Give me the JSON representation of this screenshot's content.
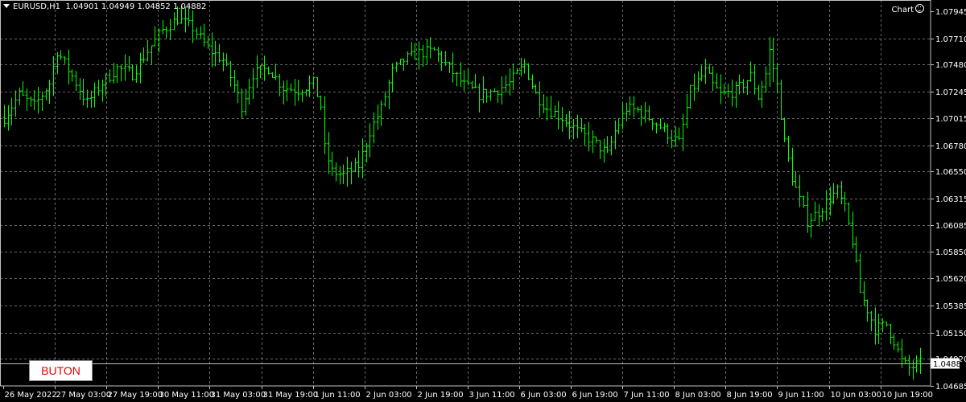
{
  "header": {
    "symbol": "EURUSD,H1",
    "ohlc": "1.04901 1.04949 1.04852 1.04882"
  },
  "chart_label": "Chart",
  "button_label": "BUTON",
  "colors": {
    "background": "#000000",
    "candle": "#00ff00",
    "grid": "#c0c0c0",
    "text": "#ffffff",
    "button_text": "#e00000",
    "current_price_line": "#c0c0c0"
  },
  "chart_data": {
    "type": "ohlc",
    "symbol": "EURUSD",
    "timeframe": "H1",
    "grid": true,
    "ylim": [
      1.04685,
      1.07945
    ],
    "y_ticks": [
      "1.07945",
      "1.07710",
      "1.07480",
      "1.07245",
      "1.07015",
      "1.06780",
      "1.06550",
      "1.06315",
      "1.06085",
      "1.05850",
      "1.05620",
      "1.05385",
      "1.05150",
      "1.04920",
      "1.04685"
    ],
    "x_ticks": [
      "26 May 2022",
      "27 May 03:00",
      "27 May 19:00",
      "30 May 11:00",
      "31 May 03:00",
      "31 May 19:00",
      "1 Jun 11:00",
      "2 Jun 03:00",
      "2 Jun 19:00",
      "3 Jun 11:00",
      "6 Jun 03:00",
      "6 Jun 19:00",
      "7 Jun 11:00",
      "8 Jun 03:00",
      "8 Jun 19:00",
      "9 Jun 11:00",
      "10 Jun 03:00",
      "10 Jun 19:00"
    ],
    "current_price": "1.04882",
    "close_path": [
      [
        0,
        1.0702
      ],
      [
        4,
        1.0722
      ],
      [
        8,
        1.0712
      ],
      [
        12,
        1.0732
      ],
      [
        14,
        1.076
      ],
      [
        18,
        1.0738
      ],
      [
        22,
        1.0715
      ],
      [
        26,
        1.0732
      ],
      [
        30,
        1.0745
      ],
      [
        34,
        1.074
      ],
      [
        38,
        1.076
      ],
      [
        42,
        1.0778
      ],
      [
        46,
        1.0788
      ],
      [
        50,
        1.078
      ],
      [
        54,
        1.0762
      ],
      [
        58,
        1.0752
      ],
      [
        61,
        1.073
      ],
      [
        63,
        1.0712
      ],
      [
        66,
        1.074
      ],
      [
        70,
        1.0745
      ],
      [
        74,
        1.0728
      ],
      [
        78,
        1.0726
      ],
      [
        82,
        1.0732
      ],
      [
        84,
        1.0712
      ],
      [
        85,
        1.0675
      ],
      [
        87,
        1.0655
      ],
      [
        90,
        1.0652
      ],
      [
        94,
        1.066
      ],
      [
        97,
        1.069
      ],
      [
        100,
        1.071
      ],
      [
        103,
        1.0742
      ],
      [
        106,
        1.0752
      ],
      [
        110,
        1.0758
      ],
      [
        114,
        1.076
      ],
      [
        118,
        1.0745
      ],
      [
        122,
        1.073
      ],
      [
        126,
        1.0722
      ],
      [
        130,
        1.0725
      ],
      [
        134,
        1.0732
      ],
      [
        138,
        1.0748
      ],
      [
        141,
        1.0722
      ],
      [
        144,
        1.071
      ],
      [
        148,
        1.0702
      ],
      [
        152,
        1.069
      ],
      [
        156,
        1.0682
      ],
      [
        160,
        1.067
      ],
      [
        162,
        1.069
      ],
      [
        165,
        1.071
      ],
      [
        168,
        1.0708
      ],
      [
        172,
        1.07
      ],
      [
        176,
        1.0688
      ],
      [
        179,
        1.068
      ],
      [
        182,
        1.0725
      ],
      [
        186,
        1.0742
      ],
      [
        188,
        1.073
      ],
      [
        190,
        1.0722
      ],
      [
        194,
        1.0725
      ],
      [
        198,
        1.0738
      ],
      [
        200,
        1.072
      ],
      [
        202,
        1.074
      ],
      [
        203,
        1.076
      ],
      [
        205,
        1.073
      ],
      [
        207,
        1.068
      ],
      [
        209,
        1.065
      ],
      [
        211,
        1.063
      ],
      [
        213,
        1.0612
      ],
      [
        216,
        1.062
      ],
      [
        219,
        1.0632
      ],
      [
        221,
        1.0638
      ],
      [
        223,
        1.0622
      ],
      [
        225,
        1.0595
      ],
      [
        227,
        1.055
      ],
      [
        229,
        1.0535
      ],
      [
        231,
        1.0518
      ],
      [
        234,
        1.0522
      ],
      [
        236,
        1.0508
      ],
      [
        238,
        1.049
      ],
      [
        240,
        1.0484
      ],
      [
        243,
        1.0488
      ]
    ],
    "bars": 244
  }
}
